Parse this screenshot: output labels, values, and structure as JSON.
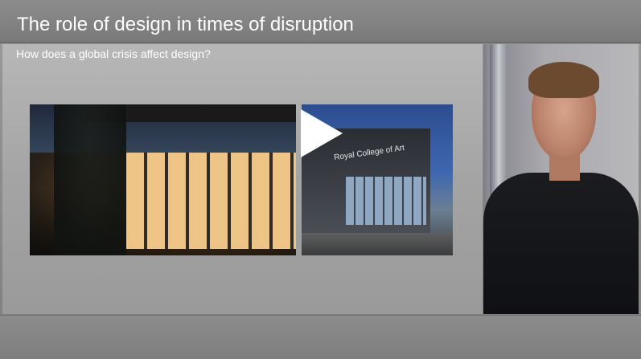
{
  "header": {
    "title": "The role of design in times of disruption"
  },
  "slide": {
    "subtitle": "How does a global crisis affect design?",
    "building_sign": "Royal College of Art"
  },
  "player": {
    "play_icon": "play-icon"
  },
  "colors": {
    "title_text": "#ffffff",
    "player_background": "#8a8a8a"
  }
}
